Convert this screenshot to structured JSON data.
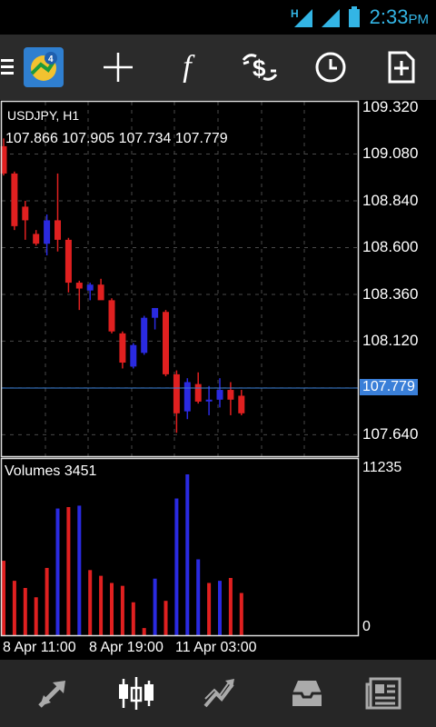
{
  "status": {
    "time": "2:33",
    "ampm": "PM",
    "network": "H"
  },
  "toolbar": {
    "items": [
      {
        "name": "menu-icon"
      },
      {
        "name": "metatrader-logo-icon"
      },
      {
        "name": "crosshair-icon"
      },
      {
        "name": "indicators-icon"
      },
      {
        "name": "trade-icon"
      },
      {
        "name": "period-clock-icon"
      },
      {
        "name": "new-order-icon"
      }
    ],
    "indicator_glyph": "f"
  },
  "chart": {
    "symbol": "USDJPY, H1",
    "ohlc": "107.866 107.905 107.734 107.779",
    "current_price": "107.779",
    "price_axis": [
      "109.320",
      "109.080",
      "108.840",
      "108.600",
      "108.360",
      "108.120",
      "107.880",
      "107.640"
    ],
    "volume_label": "Volumes 3451",
    "volume_axis_max": "11235",
    "volume_axis_min": "0",
    "time_axis": [
      "8 Apr 11:00",
      "8 Apr 19:00",
      "11 Apr 03:00"
    ],
    "colors": {
      "bull": "#2a2ae0",
      "bear": "#e02020",
      "grid": "#4a4a4a",
      "price_line": "#3a7fd8"
    }
  },
  "chart_data": {
    "type": "candlestick",
    "symbol": "USDJPY",
    "timeframe": "H1",
    "ylim": [
      107.53,
      109.32
    ],
    "candles": [
      {
        "o": 109.12,
        "h": 109.16,
        "l": 108.97,
        "c": 108.98
      },
      {
        "o": 108.98,
        "h": 108.99,
        "l": 108.69,
        "c": 108.71
      },
      {
        "o": 108.81,
        "h": 108.84,
        "l": 108.64,
        "c": 108.74
      },
      {
        "o": 108.67,
        "h": 108.69,
        "l": 108.61,
        "c": 108.62
      },
      {
        "o": 108.62,
        "h": 108.77,
        "l": 108.56,
        "c": 108.74
      },
      {
        "o": 108.74,
        "h": 108.98,
        "l": 108.58,
        "c": 108.64
      },
      {
        "o": 108.64,
        "h": 108.65,
        "l": 108.37,
        "c": 108.42
      },
      {
        "o": 108.42,
        "h": 108.43,
        "l": 108.28,
        "c": 108.39
      },
      {
        "o": 108.38,
        "h": 108.42,
        "l": 108.33,
        "c": 108.41
      },
      {
        "o": 108.41,
        "h": 108.44,
        "l": 108.35,
        "c": 108.33
      },
      {
        "o": 108.33,
        "h": 108.34,
        "l": 108.16,
        "c": 108.17
      },
      {
        "o": 108.16,
        "h": 108.17,
        "l": 107.98,
        "c": 108.01
      },
      {
        "o": 107.99,
        "h": 108.11,
        "l": 107.98,
        "c": 108.1
      },
      {
        "o": 108.06,
        "h": 108.25,
        "l": 108.05,
        "c": 108.24
      },
      {
        "o": 108.24,
        "h": 108.29,
        "l": 108.18,
        "c": 108.29
      },
      {
        "o": 108.27,
        "h": 108.28,
        "l": 107.94,
        "c": 107.95
      },
      {
        "o": 107.95,
        "h": 107.97,
        "l": 107.65,
        "c": 107.75
      },
      {
        "o": 107.76,
        "h": 107.93,
        "l": 107.72,
        "c": 107.91
      },
      {
        "o": 107.9,
        "h": 107.96,
        "l": 107.8,
        "c": 107.81
      },
      {
        "o": 107.82,
        "h": 107.89,
        "l": 107.74,
        "c": 107.82
      },
      {
        "o": 107.82,
        "h": 107.93,
        "l": 107.78,
        "c": 107.87
      },
      {
        "o": 107.87,
        "h": 107.91,
        "l": 107.74,
        "c": 107.82
      },
      {
        "o": 107.84,
        "h": 107.87,
        "l": 107.74,
        "c": 107.75
      }
    ],
    "volumes": [
      {
        "v": 5200,
        "dir": "bear"
      },
      {
        "v": 3800,
        "dir": "bear"
      },
      {
        "v": 3300,
        "dir": "bear"
      },
      {
        "v": 2650,
        "dir": "bear"
      },
      {
        "v": 4700,
        "dir": "bear"
      },
      {
        "v": 8850,
        "dir": "bull"
      },
      {
        "v": 8950,
        "dir": "bear"
      },
      {
        "v": 9050,
        "dir": "bull"
      },
      {
        "v": 4550,
        "dir": "bear"
      },
      {
        "v": 4150,
        "dir": "bear"
      },
      {
        "v": 3650,
        "dir": "bear"
      },
      {
        "v": 3450,
        "dir": "bear"
      },
      {
        "v": 2300,
        "dir": "bear"
      },
      {
        "v": 500,
        "dir": "bear"
      },
      {
        "v": 3950,
        "dir": "bull"
      },
      {
        "v": 2400,
        "dir": "bear"
      },
      {
        "v": 9550,
        "dir": "bull"
      },
      {
        "v": 11235,
        "dir": "bull"
      },
      {
        "v": 5300,
        "dir": "bull"
      },
      {
        "v": 3650,
        "dir": "bear"
      },
      {
        "v": 3800,
        "dir": "bull"
      },
      {
        "v": 4000,
        "dir": "bear"
      },
      {
        "v": 2950,
        "dir": "bear"
      }
    ],
    "volume_ylim": [
      0,
      11235
    ]
  },
  "bottom_nav": [
    {
      "name": "nav-quotes-icon"
    },
    {
      "name": "nav-chart-icon"
    },
    {
      "name": "nav-trade-icon"
    },
    {
      "name": "nav-history-icon"
    },
    {
      "name": "nav-news-icon"
    }
  ]
}
